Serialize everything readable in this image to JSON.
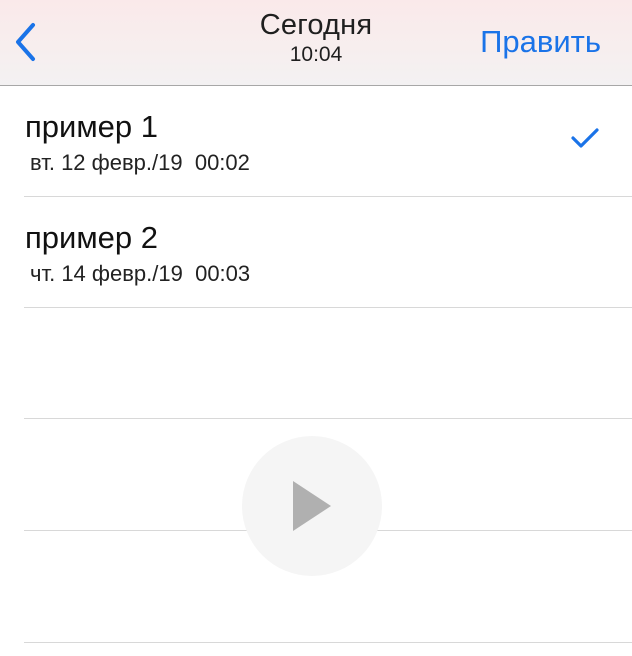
{
  "nav": {
    "back_icon": "chevron-left-icon",
    "title": "Сегодня",
    "subtitle": "10:04",
    "edit_label": "Править"
  },
  "recordings": [
    {
      "title": "пример 1",
      "meta": "вт. 12 февр./19  00:02",
      "selected": true,
      "icon": "checkmark-icon"
    },
    {
      "title": "пример 2",
      "meta": "чт. 14 февр./19  00:03",
      "selected": false
    }
  ],
  "empty_rows": 3,
  "player": {
    "icon": "play-icon"
  },
  "colors": {
    "accent": "#1a73e8",
    "play_icon": "#b0b0b0",
    "play_background": "#f5f5f5",
    "separator": "#d8d8d8"
  }
}
